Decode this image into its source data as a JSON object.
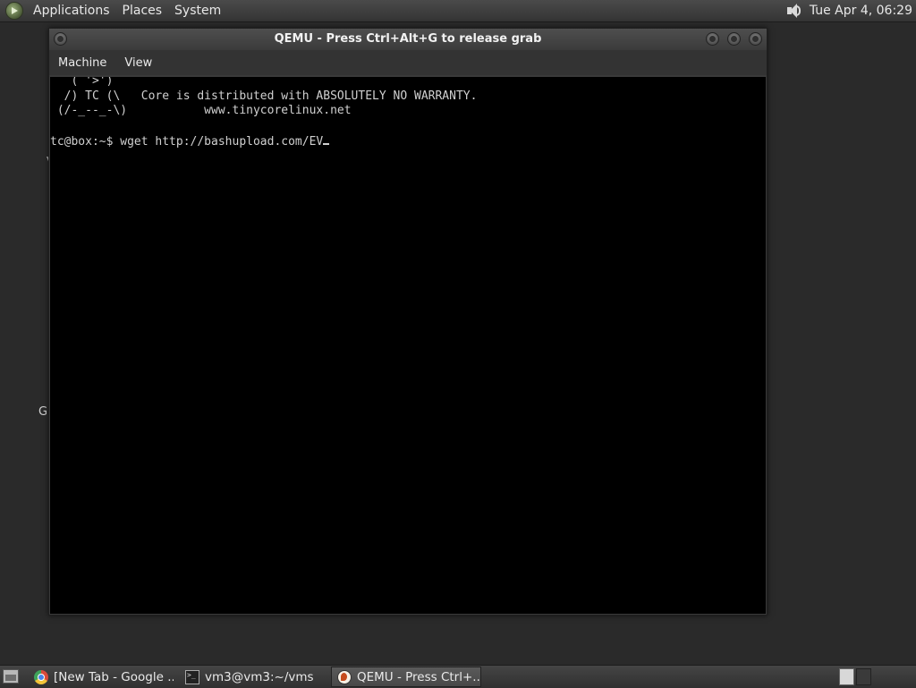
{
  "top_panel": {
    "menus": [
      "Applications",
      "Places",
      "System"
    ],
    "clock": "Tue Apr  4, 06:29"
  },
  "desktop": {
    "peek_letters": [
      "V",
      "G"
    ]
  },
  "qemu_window": {
    "title": "QEMU - Press Ctrl+Alt+G to release grab",
    "menu": [
      "Machine",
      "View"
    ],
    "console_lines": [
      "   ( '>')",
      "  /) TC (\\   Core is distributed with ABSOLUTELY NO WARRANTY.",
      " (/-_--_-\\)           www.tinycorelinux.net",
      "",
      "tc@box:~$ wget http://bashupload.com/EV"
    ]
  },
  "taskbar": {
    "tasks": [
      {
        "label": "[New Tab - Google ...",
        "icon": "chrome-icon",
        "active": false
      },
      {
        "label": "vm3@vm3:~/vms",
        "icon": "terminal-icon",
        "active": false
      },
      {
        "label": "QEMU - Press Ctrl+...",
        "icon": "qemu-icon",
        "active": true
      }
    ]
  }
}
